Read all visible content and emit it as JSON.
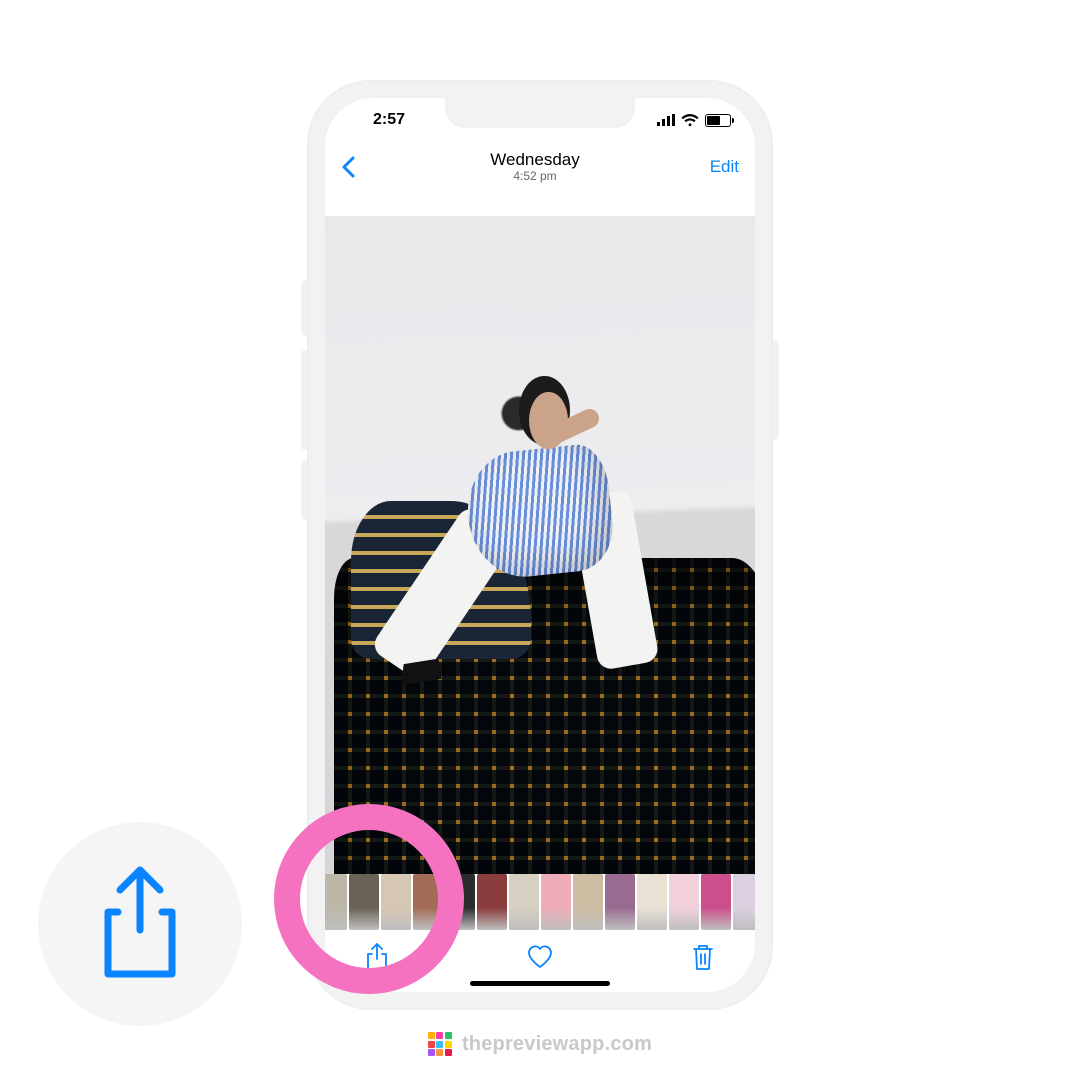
{
  "status": {
    "time": "2:57"
  },
  "nav": {
    "day": "Wednesday",
    "time": "4:52 pm",
    "edit_label": "Edit"
  },
  "toolbar": {
    "share_label": "Share",
    "favorite_label": "Favorite",
    "delete_label": "Delete"
  },
  "thumbnails": {
    "colors": [
      "#bdb7a8",
      "#6b6257",
      "#d6c6b4",
      "#a26c58",
      "#2b2b2b",
      "#8b3c3c",
      "#d6cfc2",
      "#efadb9",
      "#cdbda3",
      "#9a6b90",
      "#e8e1d4",
      "#f1d0dc",
      "#cc4f8c",
      "#dccfe0"
    ]
  },
  "watermark": {
    "text": "thepreviewapp.com"
  },
  "colors": {
    "ios_blue": "#0a84ff",
    "highlight_pink": "#f472c0"
  }
}
